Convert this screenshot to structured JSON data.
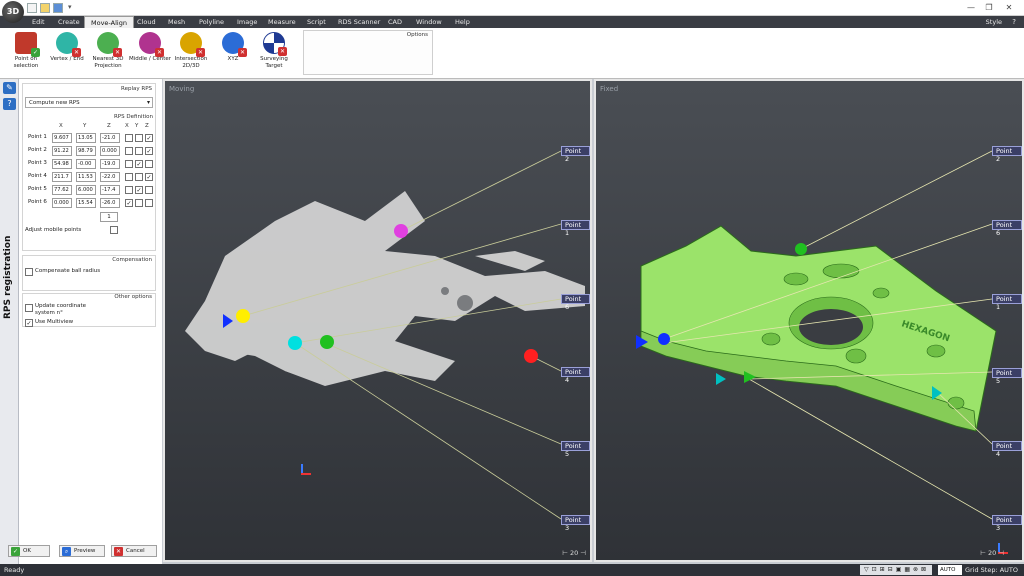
{
  "app": {
    "logo": "3D",
    "style_label": "Style",
    "window_controls": [
      "—",
      "❐",
      "✕"
    ]
  },
  "menu": [
    "Edit",
    "Create",
    "Move-Align",
    "Cloud",
    "Mesh",
    "Polyline",
    "Image",
    "Measure",
    "Script",
    "RDS Scanner",
    "CAD",
    "Window",
    "Help"
  ],
  "ribbon": {
    "buttons": [
      {
        "label": "Point on selection",
        "icon": "pointer-select-icon",
        "color": "#c0392b"
      },
      {
        "label": "Vertex / End",
        "icon": "vertex-icon",
        "color": "#2fb5a6"
      },
      {
        "label": "Nearest 3D Projection",
        "icon": "projection-icon",
        "color": "#4caf50"
      },
      {
        "label": "Middle / Center",
        "icon": "center-icon",
        "color": "#b0338f"
      },
      {
        "label": "Intersection 2D/3D",
        "icon": "intersection-icon",
        "color": "#d9a400"
      },
      {
        "label": "XYZ",
        "icon": "crosshair-icon",
        "color": "#2b6cd6"
      },
      {
        "label": "Surveying Target",
        "icon": "target-icon",
        "color": "#1f3a93"
      }
    ],
    "options_label": "Options"
  },
  "panel": {
    "vertical_title": "RPS registration",
    "replay_label": "Replay RPS",
    "combo_value": "Compute new RPS",
    "rps_definition_label": "RPS Definition",
    "headers": [
      "X",
      "Y",
      "Z",
      "X",
      "Y",
      "Z"
    ],
    "points": [
      {
        "label": "Point 1",
        "x": "9.607",
        "y": "13.05",
        "z": "-21.0",
        "cx": false,
        "cy": false,
        "cz": true
      },
      {
        "label": "Point 2",
        "x": "91.22",
        "y": "98.79",
        "z": "0.000",
        "cx": false,
        "cy": false,
        "cz": true
      },
      {
        "label": "Point 3",
        "x": "54.98",
        "y": "-0.00",
        "z": "-19.0",
        "cx": false,
        "cy": true,
        "cz": false
      },
      {
        "label": "Point 4",
        "x": "211.7",
        "y": "11.53",
        "z": "-22.0",
        "cx": false,
        "cy": false,
        "cz": true
      },
      {
        "label": "Point 5",
        "x": "77.62",
        "y": "6.000",
        "z": "-17.4",
        "cx": false,
        "cy": true,
        "cz": false
      },
      {
        "label": "Point 6",
        "x": "0.000",
        "y": "15.54",
        "z": "-26.0",
        "cx": true,
        "cy": false,
        "cz": false
      }
    ],
    "count_value": "1",
    "adjust_label": "Adjust mobile points",
    "compensation_label": "Compensation",
    "compensate_label": "Compensate ball radius",
    "other_options_label": "Other options",
    "update_coord_label": "Update coordinate system n°",
    "use_multiview_label": "Use Multiview",
    "ok_label": "OK",
    "preview_label": "Preview",
    "cancel_label": "Cancel"
  },
  "viewports": {
    "moving_title": "Moving",
    "fixed_title": "Fixed",
    "scale_label": "20",
    "moving_callouts": [
      "Point 2",
      "Point 1",
      "Point 6",
      "Point 4",
      "Point 5",
      "Point 3"
    ],
    "fixed_callouts": [
      "Point 2",
      "Point 6",
      "Point 1",
      "Point 5",
      "Point 4",
      "Point 3"
    ],
    "mesh_color": "#9be36a",
    "cloud_color": "#d8d8d8",
    "marker_colors": [
      "#e040e0",
      "#ffee00",
      "#00e0e0",
      "#20c020",
      "#ff2020",
      "#1030ff"
    ],
    "fixed_text": "HEXAGON"
  },
  "status": {
    "text": "Ready",
    "auto_label": "AUTO",
    "grid_step": "Grid Step: AUTO"
  }
}
